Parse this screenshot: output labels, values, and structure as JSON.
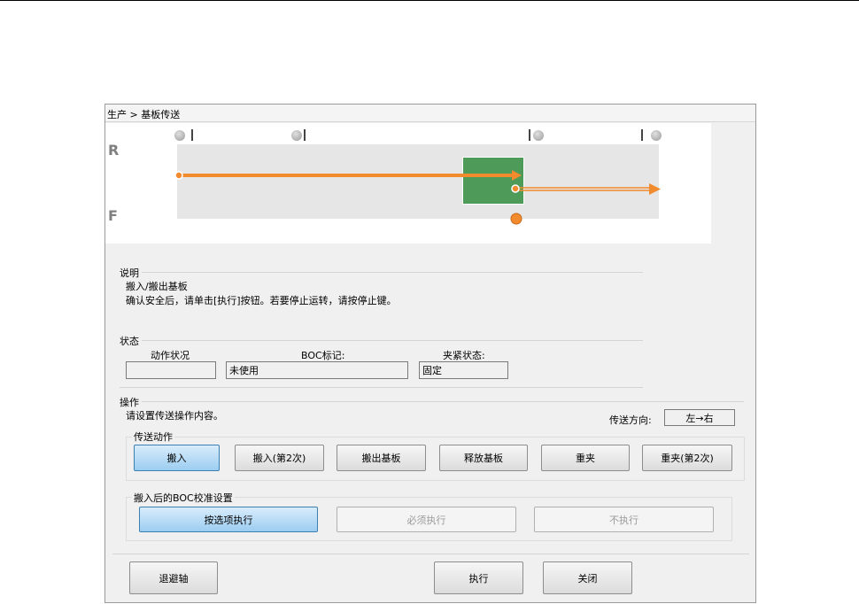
{
  "breadcrumb": "生产 > 基板传送",
  "diagram": {
    "rear_label": "R",
    "front_label": "F",
    "board_color": "#4e9a59",
    "arrow_color": "#f28a2e"
  },
  "explain": {
    "title": "说明",
    "line1": "搬入/搬出基板",
    "line2": "确认安全后，请单击[执行]按钮。若要停止运转，请按停止键。"
  },
  "status": {
    "title": "状态",
    "col1_label": "动作状况",
    "col1_value": "",
    "col2_label": "BOC标记:",
    "col2_value": "未使用",
    "col3_label": "夹紧状态:",
    "col3_value": "固定"
  },
  "operation": {
    "title": "操作",
    "prompt": "请设置传送操作内容。",
    "direction_label": "传送方向:",
    "direction_value": "左→右",
    "transfer_group": "传送动作",
    "buttons": [
      "搬入",
      "搬入(第2次)",
      "搬出基板",
      "释放基板",
      "重夹",
      "重夹(第2次)"
    ],
    "boc_group": "搬入后的BOC校准设置",
    "boc_buttons": [
      "按选项执行",
      "必须执行",
      "不执行"
    ]
  },
  "footer": {
    "retreat": "退避轴",
    "execute": "执行",
    "close": "关闭"
  }
}
